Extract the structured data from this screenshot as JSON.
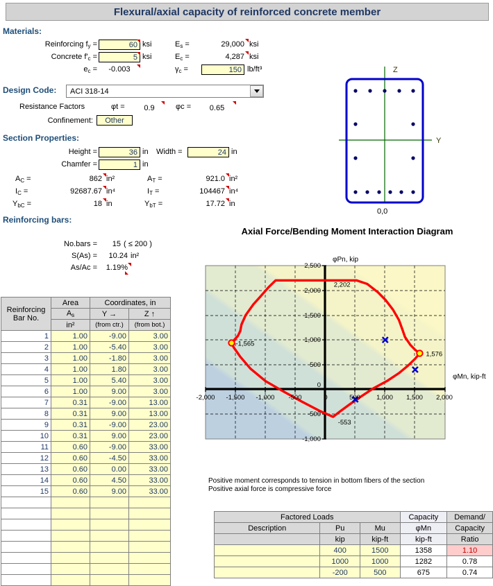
{
  "title": "Flexural/axial capacity of reinforced concrete member",
  "materials": {
    "heading": "Materials:",
    "fy_label": "Reinforcing f",
    "fy_sub": "y",
    "fy_value": "60",
    "fy_unit": "ksi",
    "fc_label": "Concrete f'",
    "fc_sub": "c",
    "fc_value": "5",
    "fc_unit": "ksi",
    "ec_label": "e",
    "ec_sub": "c",
    "ec_value": "-0.003",
    "Es_label": "E",
    "Es_sub": "s",
    "Es_value": "29,000",
    "Es_unit": "ksi",
    "Ec_label": "E",
    "Ec_sub": "c",
    "Ec_value": "4,287",
    "Ec_unit": "ksi",
    "gc_label": "γ",
    "gc_sub": "c",
    "gc_value": "150",
    "gc_unit": "lb/ft³"
  },
  "design_code": {
    "heading": "Design Code:",
    "selected": "ACI 318-14",
    "resistance_label": "Resistance Factors",
    "phit_label": "φt =",
    "phit_value": "0.9",
    "phic_label": "φc =",
    "phic_value": "0.65",
    "confinement_label": "Confinement:",
    "confinement_value": "Other"
  },
  "section": {
    "heading": "Section Properties:",
    "height_label": "Height =",
    "height_value": "36",
    "height_unit": "in",
    "width_label": "Width =",
    "width_value": "24",
    "width_unit": "in",
    "chamfer_label": "Chamfer =",
    "chamfer_value": "1",
    "chamfer_unit": "in",
    "Ac_label": "A",
    "Ac_sub": "C",
    "Ac_value": "862",
    "Ac_unit": "in²",
    "At_label": "A",
    "At_sub": "T",
    "At_value": "921.0",
    "At_unit": "in²",
    "Ic_label": "I",
    "Ic_sub": "C",
    "Ic_value": "92687.67",
    "Ic_unit": "in⁴",
    "It_label": "I",
    "It_sub": "T",
    "It_value": "104467",
    "It_unit": "in⁴",
    "Ybc_label": "Y",
    "Ybc_sub": "bC",
    "Ybc_value": "18",
    "Ybc_unit": "in",
    "Ybt_label": "Y",
    "Ybt_sub": "bT",
    "Ybt_value": "17.72",
    "Ybt_unit": "in"
  },
  "rebar_summary": {
    "heading": "Reinforcing bars:",
    "nobars_label": "No.bars =",
    "nobars_value": "15",
    "nobars_limit": "( ≤ 200 )",
    "sas_label": "S(As) =",
    "sas_value": "10.24",
    "sas_unit": "in²",
    "asac_label": "As/Ac =",
    "asac_value": "1.19%"
  },
  "section_diagram": {
    "axis_z": "Z",
    "axis_y": "Y",
    "origin": "0,0"
  },
  "bar_table": {
    "headers": {
      "bar_no": "Reinforcing Bar No.",
      "area": "Area",
      "area_sym": "A",
      "area_sub": "s",
      "area_unit": "in²",
      "coords": "Coordinates, in",
      "y": "Y →",
      "y_ref": "(from ctr.)",
      "z": "Z ↑",
      "z_ref": "(from bot.)"
    },
    "rows": [
      {
        "no": "1",
        "as": "1.00",
        "y": "-9.00",
        "z": "3.00"
      },
      {
        "no": "2",
        "as": "1.00",
        "y": "-5.40",
        "z": "3.00"
      },
      {
        "no": "3",
        "as": "1.00",
        "y": "-1.80",
        "z": "3.00"
      },
      {
        "no": "4",
        "as": "1.00",
        "y": "1.80",
        "z": "3.00"
      },
      {
        "no": "5",
        "as": "1.00",
        "y": "5.40",
        "z": "3.00"
      },
      {
        "no": "6",
        "as": "1.00",
        "y": "9.00",
        "z": "3.00"
      },
      {
        "no": "7",
        "as": "0.31",
        "y": "-9.00",
        "z": "13.00"
      },
      {
        "no": "8",
        "as": "0.31",
        "y": "9.00",
        "z": "13.00"
      },
      {
        "no": "9",
        "as": "0.31",
        "y": "-9.00",
        "z": "23.00"
      },
      {
        "no": "10",
        "as": "0.31",
        "y": "9.00",
        "z": "23.00"
      },
      {
        "no": "11",
        "as": "0.60",
        "y": "-9.00",
        "z": "33.00"
      },
      {
        "no": "12",
        "as": "0.60",
        "y": "-4.50",
        "z": "33.00"
      },
      {
        "no": "13",
        "as": "0.60",
        "y": "0.00",
        "z": "33.00"
      },
      {
        "no": "14",
        "as": "0.60",
        "y": "4.50",
        "z": "33.00"
      },
      {
        "no": "15",
        "as": "0.60",
        "y": "9.00",
        "z": "33.00"
      },
      {
        "no": "",
        "as": "",
        "y": "",
        "z": ""
      },
      {
        "no": "",
        "as": "",
        "y": "",
        "z": ""
      },
      {
        "no": "",
        "as": "",
        "y": "",
        "z": ""
      },
      {
        "no": "",
        "as": "",
        "y": "",
        "z": ""
      },
      {
        "no": "",
        "as": "",
        "y": "",
        "z": ""
      },
      {
        "no": "",
        "as": "",
        "y": "",
        "z": ""
      },
      {
        "no": "",
        "as": "",
        "y": "",
        "z": ""
      },
      {
        "no": "",
        "as": "",
        "y": "",
        "z": ""
      }
    ]
  },
  "notes": {
    "line1": "Positive moment  corresponds to tension in bottom  fibers of the section",
    "line2": "Positive axial force is compressive force"
  },
  "loads_table": {
    "group_loads": "Factored Loads",
    "group_capacity": "Capacity",
    "group_demand": "Demand/",
    "headers": {
      "description": "Description",
      "pu": "Pu",
      "pu_unit": "kip",
      "mu": "Mu",
      "mu_unit": "kip-ft",
      "phimn": "φMn",
      "phimn_unit": "kip-ft",
      "capacity2": "Capacity",
      "ratio": "Ratio"
    },
    "rows": [
      {
        "description": "",
        "pu": "400",
        "mu": "1500",
        "phimn": "1358",
        "ratio": "1.10",
        "over": true
      },
      {
        "description": "",
        "pu": "1000",
        "mu": "1000",
        "phimn": "1282",
        "ratio": "0.78",
        "over": false
      },
      {
        "description": "",
        "pu": "-200",
        "mu": "500",
        "phimn": "675",
        "ratio": "0.74",
        "over": false
      }
    ]
  },
  "chart_data": {
    "type": "line",
    "title": "Axial Force/Bending Moment Interaction Diagram",
    "xlabel": "φMn, kip-ft",
    "ylabel": "φPn, kip",
    "xlim": [
      -2000,
      2000
    ],
    "ylim": [
      -1000,
      2500
    ],
    "xticks": [
      -2000,
      -1500,
      -1000,
      -500,
      0,
      500,
      1000,
      1500,
      2000
    ],
    "xtick_labels": [
      "-2,000",
      "-1,500",
      "-1,000",
      "-500",
      "0",
      "500",
      "1,000",
      "1,500",
      "2,000"
    ],
    "yticks": [
      -1000,
      -500,
      0,
      500,
      1000,
      1500,
      2000,
      2500
    ],
    "ytick_labels": [
      "-1,000",
      "-500",
      "0",
      "500",
      "1,000",
      "1,500",
      "2,000",
      "2,500"
    ],
    "grid": true,
    "legend": "none",
    "series": [
      {
        "name": "Capacity envelope",
        "color": "#ff0000",
        "points": [
          [
            -1565,
            940
          ],
          [
            -1460,
            1080
          ],
          [
            -1420,
            1180
          ],
          [
            -1400,
            1310
          ],
          [
            -1330,
            1500
          ],
          [
            -1200,
            1720
          ],
          [
            -1080,
            1880
          ],
          [
            -950,
            2060
          ],
          [
            -830,
            2202
          ],
          [
            520,
            2202
          ],
          [
            700,
            2130
          ],
          [
            880,
            1960
          ],
          [
            1010,
            1800
          ],
          [
            1130,
            1610
          ],
          [
            1230,
            1400
          ],
          [
            1290,
            1200
          ],
          [
            1330,
            1060
          ],
          [
            1420,
            900
          ],
          [
            1500,
            800
          ],
          [
            1576,
            730
          ],
          [
            1500,
            620
          ],
          [
            1380,
            480
          ],
          [
            1230,
            330
          ],
          [
            1030,
            170
          ],
          [
            800,
            20
          ],
          [
            600,
            -140
          ],
          [
            420,
            -290
          ],
          [
            250,
            -440
          ],
          [
            130,
            -553
          ],
          [
            -100,
            -430
          ],
          [
            -400,
            -240
          ],
          [
            -700,
            -40
          ],
          [
            -1000,
            170
          ],
          [
            -1250,
            420
          ],
          [
            -1420,
            660
          ],
          [
            -1530,
            850
          ],
          [
            -1565,
            940
          ]
        ]
      }
    ],
    "markers": [
      {
        "label": "-1,565",
        "x": -1565,
        "y": 940,
        "type": "endpoint",
        "fill": "#ffff00",
        "stroke": "#ff0000"
      },
      {
        "label": "2,202",
        "x": 200,
        "y": 2202,
        "type": "annotation"
      },
      {
        "label": "1,576",
        "x": 1576,
        "y": 730,
        "type": "endpoint",
        "fill": "#ffff00",
        "stroke": "#ff0000"
      },
      {
        "label": "-553",
        "x": 130,
        "y": -553,
        "type": "annotation"
      }
    ],
    "load_points": [
      {
        "x": 1500,
        "y": 400,
        "color": "#0000cc",
        "symbol": "x"
      },
      {
        "x": 1000,
        "y": 1000,
        "color": "#0000cc",
        "symbol": "x"
      },
      {
        "x": 500,
        "y": -200,
        "color": "#0000cc",
        "symbol": "x"
      }
    ]
  }
}
